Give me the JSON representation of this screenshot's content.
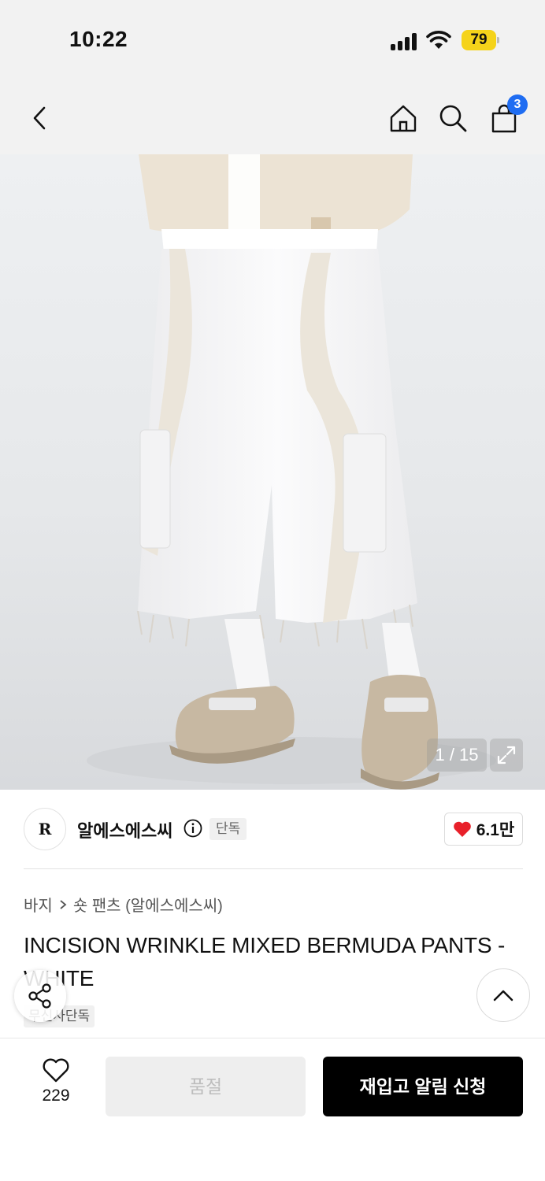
{
  "status_bar": {
    "time": "10:22",
    "battery": "79"
  },
  "nav": {
    "cart_count": "3"
  },
  "gallery": {
    "counter": "1 / 15"
  },
  "brand": {
    "logo_text": "R",
    "name": "알에스에스씨",
    "exclusive_tag": "단독",
    "likes": "6.1만"
  },
  "breadcrumb": {
    "category": "바지",
    "subcategory": "숏 팬츠 (알에스에스씨)"
  },
  "product": {
    "title": "INCISION WRINKLE MIXED BERMUDA PANTS - WHITE",
    "tag": "무신사단독"
  },
  "bottom_bar": {
    "wish_count": "229",
    "soldout_label": "품절",
    "restock_label": "재입고 알림 신청"
  },
  "colors": {
    "accent_blue": "#1f6df2",
    "heart_red": "#e8202a",
    "battery_yellow": "#f5d31a"
  }
}
